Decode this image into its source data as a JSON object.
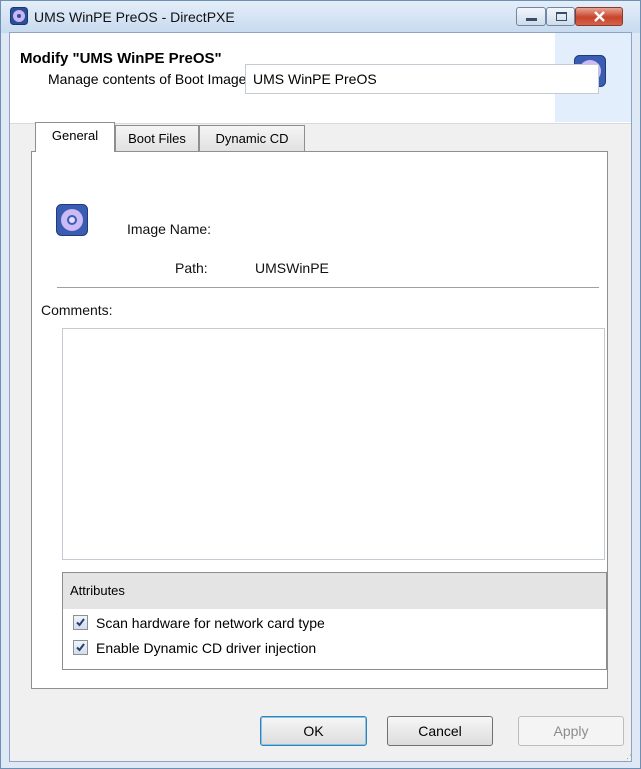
{
  "window": {
    "title": "UMS WinPE PreOS - DirectPXE",
    "icon": "disc-icon"
  },
  "header": {
    "title": "Modify \"UMS WinPE PreOS\"",
    "subtitle": "Manage contents of Boot Image."
  },
  "tabs": [
    {
      "label": "General",
      "active": true
    },
    {
      "label": "Boot Files",
      "active": false
    },
    {
      "label": "Dynamic CD",
      "active": false
    }
  ],
  "general": {
    "image_name_label": "Image Name:",
    "image_name_value": "UMS WinPE PreOS",
    "path_label": "Path:",
    "path_value": "UMSWinPE",
    "comments_label": "Comments:",
    "comments_value": ""
  },
  "attributes": {
    "title": "Attributes",
    "items": [
      {
        "label": "Scan hardware for network card type",
        "checked": true
      },
      {
        "label": "Enable Dynamic CD driver injection",
        "checked": true
      }
    ]
  },
  "buttons": {
    "ok": "OK",
    "cancel": "Cancel",
    "apply": "Apply"
  },
  "colors": {
    "accent": "#3c7fb1",
    "close_button": "#c7432a"
  }
}
